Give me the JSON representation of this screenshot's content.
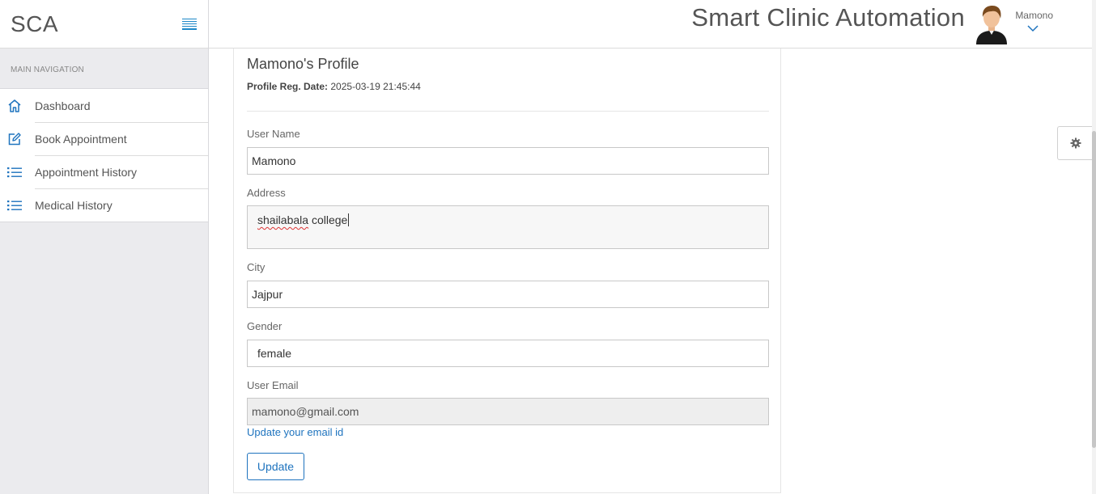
{
  "sidebar": {
    "brand": "SCA",
    "nav_header": "MAIN NAVIGATION",
    "items": [
      {
        "label": "Dashboard",
        "icon": "home-icon"
      },
      {
        "label": "Book Appointment",
        "icon": "edit-icon"
      },
      {
        "label": "Appointment History",
        "icon": "list-icon"
      },
      {
        "label": "Medical History",
        "icon": "list-icon"
      }
    ]
  },
  "header": {
    "title": "Smart Clinic Automation",
    "user_name": "Mamono"
  },
  "profile": {
    "title": "Mamono's Profile",
    "reg_label": "Profile Reg. Date:",
    "reg_date": "2025-03-19 21:45:44",
    "fields": {
      "username_label": "User Name",
      "username_value": "Mamono",
      "address_label": "Address",
      "address_value_word1": "shailabala",
      "address_value_word2": " college",
      "city_label": "City",
      "city_value": "Jajpur",
      "gender_label": "Gender",
      "gender_value": "female",
      "email_label": "User Email",
      "email_value": "mamono@gmail.com"
    },
    "update_email_link": "Update your email id",
    "update_button": "Update"
  },
  "colors": {
    "accent": "#1e73be",
    "sidebar_bg": "#ebebee",
    "disabled_bg": "#eeeeee"
  }
}
